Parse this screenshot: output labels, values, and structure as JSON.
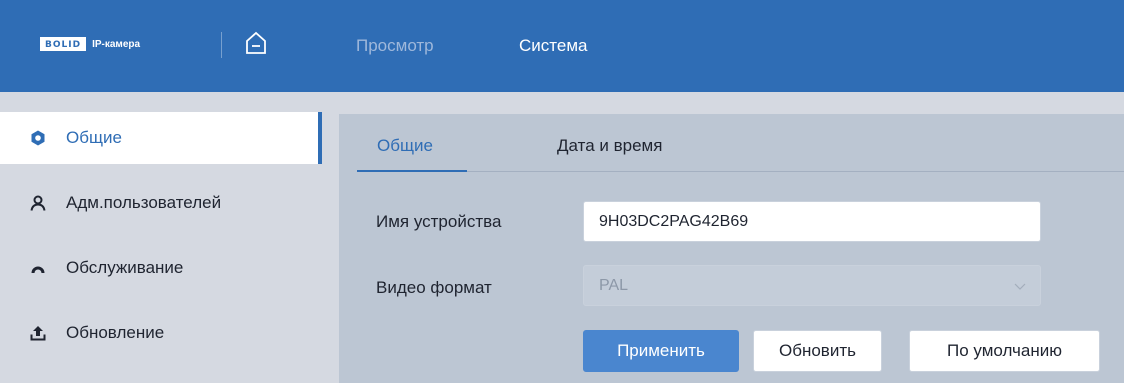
{
  "header": {
    "logo_box": "BOLID",
    "logo_text": "IP-камера",
    "nav": [
      {
        "label": "Просмотр"
      },
      {
        "label": "Система"
      }
    ],
    "colors": {
      "background": "#2f6db5",
      "active_nav": "#ffffff",
      "inactive_nav": "#9fb8db"
    }
  },
  "sidebar": {
    "items": [
      {
        "label": "Общие",
        "icon": "gear-icon",
        "active": true
      },
      {
        "label": "Адм.пользователей",
        "icon": "user-icon",
        "active": false
      },
      {
        "label": "Обслуживание",
        "icon": "gauge-icon",
        "active": false
      },
      {
        "label": "Обновление",
        "icon": "upload-icon",
        "active": false
      }
    ]
  },
  "main": {
    "tabs": [
      {
        "label": "Общие",
        "active": true
      },
      {
        "label": "Дата и время",
        "active": false
      }
    ],
    "form": {
      "device_name_label": "Имя устройства",
      "device_name_value": "9H03DC2PAG42B69",
      "video_format_label": "Видео формат",
      "video_format_value": "PAL"
    },
    "buttons": {
      "apply": "Применить",
      "refresh": "Обновить",
      "default": "По умолчанию"
    }
  }
}
